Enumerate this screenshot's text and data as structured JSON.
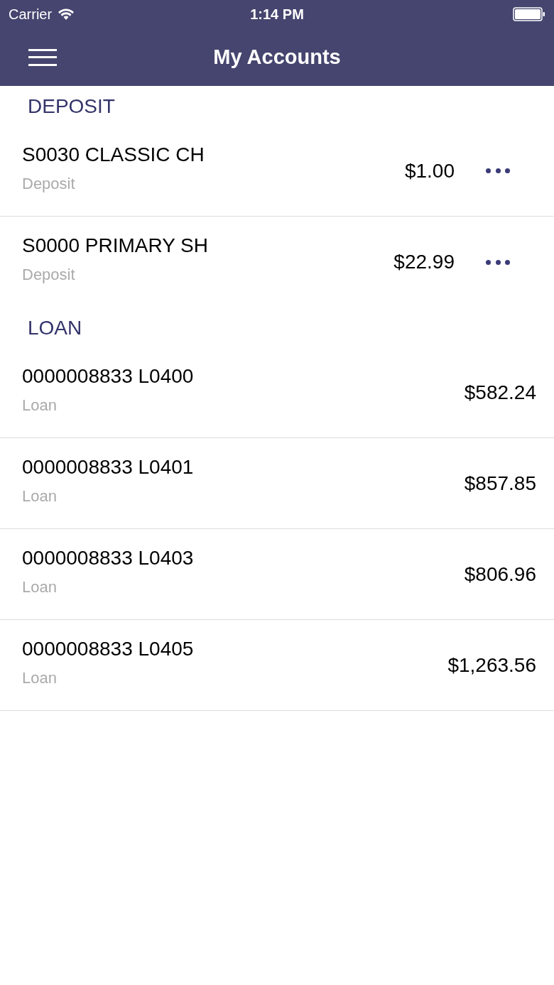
{
  "status_bar": {
    "carrier": "Carrier",
    "time": "1:14 PM"
  },
  "nav_bar": {
    "title": "My Accounts"
  },
  "sections": [
    {
      "title": "DEPOSIT",
      "accounts": [
        {
          "name": "S0030 CLASSIC CH",
          "type": "Deposit",
          "balance": "$1.00",
          "has_menu": true
        },
        {
          "name": "S0000 PRIMARY SH",
          "type": "Deposit",
          "balance": "$22.99",
          "has_menu": true
        }
      ]
    },
    {
      "title": "LOAN",
      "accounts": [
        {
          "name": "0000008833 L0400",
          "type": "Loan",
          "balance": "$582.24",
          "has_menu": false
        },
        {
          "name": "0000008833 L0401",
          "type": "Loan",
          "balance": "$857.85",
          "has_menu": false
        },
        {
          "name": "0000008833 L0403",
          "type": "Loan",
          "balance": "$806.96",
          "has_menu": false
        },
        {
          "name": "0000008833 L0405",
          "type": "Loan",
          "balance": "$1,263.56",
          "has_menu": false
        }
      ]
    }
  ]
}
